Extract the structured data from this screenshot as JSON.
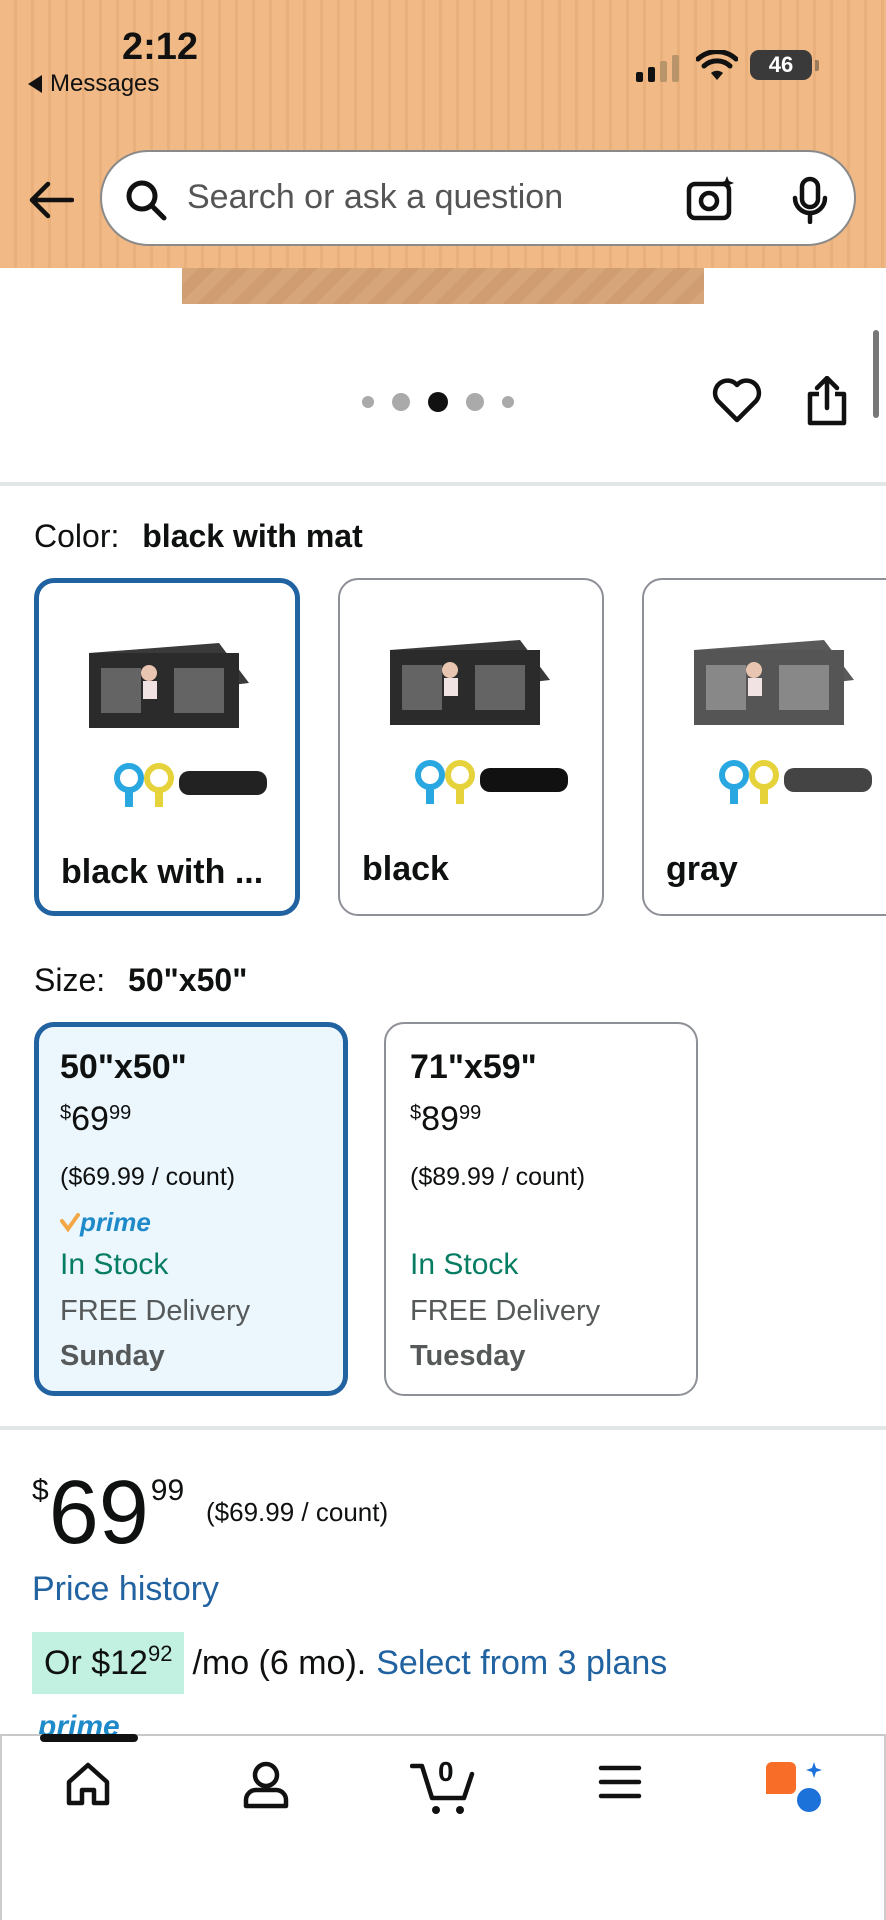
{
  "status_bar": {
    "time": "2:12",
    "back_app": "Messages",
    "battery": "46"
  },
  "search": {
    "placeholder": "Search or ask a question"
  },
  "gallery": {
    "dot_count": 5,
    "active_dot": 3
  },
  "color": {
    "label": "Color:",
    "selected": "black with mat",
    "options": [
      {
        "label": "black with ...",
        "selected": true
      },
      {
        "label": "black",
        "selected": false
      },
      {
        "label": "gray",
        "selected": false
      }
    ]
  },
  "size": {
    "label": "Size:",
    "selected": "50\"x50\"",
    "options": [
      {
        "title": "50\"x50\"",
        "currency": "$",
        "whole": "69",
        "fraction": "99",
        "unit_price": "($69.99 / count)",
        "prime": "prime",
        "stock": "In Stock",
        "delivery": "FREE Delivery",
        "day": "Sunday",
        "selected": true
      },
      {
        "title": "71\"x59\"",
        "currency": "$",
        "whole": "89",
        "fraction": "99",
        "unit_price": "($89.99 / count)",
        "prime": "",
        "stock": "In Stock",
        "delivery": "FREE Delivery",
        "day": "Tuesday",
        "selected": false
      }
    ]
  },
  "price": {
    "currency": "$",
    "whole": "69",
    "fraction": "99",
    "unit_price": "($69.99 / count)",
    "history_link": "Price history"
  },
  "financing": {
    "prefix": "Or $",
    "whole": "12",
    "fraction": "92",
    "suffix": "/mo (6 mo).",
    "link": "Select from 3 plans"
  },
  "prime_peek": "prime",
  "bottom_nav": {
    "cart_count": "0",
    "items": [
      "home-icon",
      "account-icon",
      "cart-icon",
      "menu-icon",
      "rufus-assistant-icon"
    ]
  },
  "colors": {
    "accent_blue": "#2162a1",
    "stock_green": "#067d62",
    "prime_blue": "#1f8ac9",
    "header_bg": "#f0b985"
  }
}
